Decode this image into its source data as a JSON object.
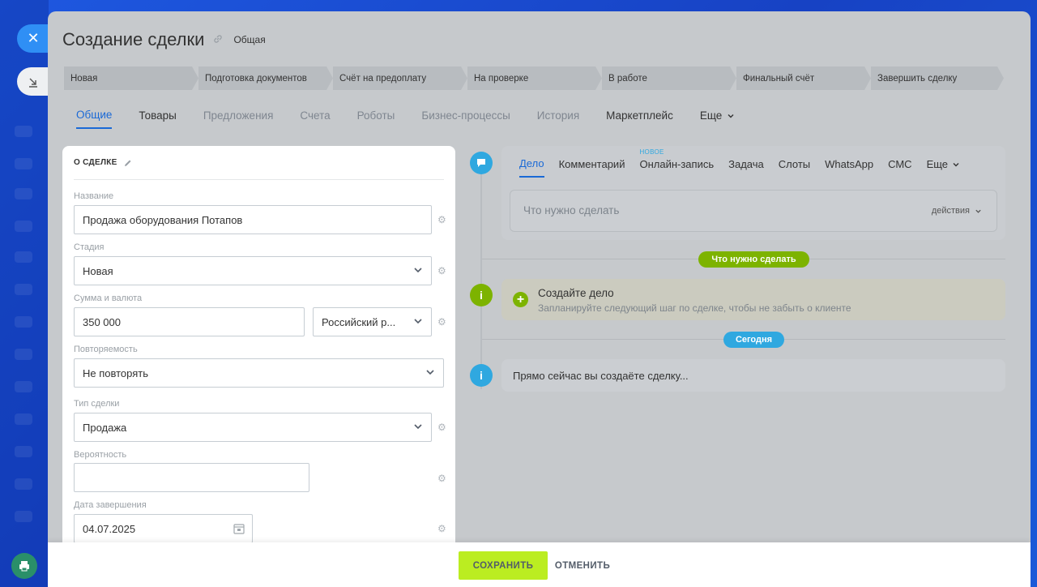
{
  "window": {
    "title": "Создание сделки",
    "category": "Общая"
  },
  "stages": [
    "Новая",
    "Подготовка документов",
    "Счёт на предоплату",
    "На проверке",
    "В работе",
    "Финальный счёт",
    "Завершить сделку"
  ],
  "tabs": [
    {
      "label": "Общие",
      "state": "active"
    },
    {
      "label": "Товары",
      "state": "dark"
    },
    {
      "label": "Предложения",
      "state": "muted"
    },
    {
      "label": "Счета",
      "state": "muted"
    },
    {
      "label": "Роботы",
      "state": "muted"
    },
    {
      "label": "Бизнес-процессы",
      "state": "muted"
    },
    {
      "label": "История",
      "state": "muted"
    },
    {
      "label": "Маркетплейс",
      "state": "dark"
    },
    {
      "label": "Еще",
      "state": "dark"
    }
  ],
  "deal_card": {
    "header": "О СДЕЛКЕ",
    "name_label": "Название",
    "name_value": "Продажа оборудования Потапов",
    "stage_label": "Стадия",
    "stage_value": "Новая",
    "amount_label": "Сумма и валюта",
    "amount_value": "350 000",
    "currency_value": "Российский р...",
    "repeat_label": "Повторяемость",
    "repeat_value": "Не повторять",
    "type_label": "Тип сделки",
    "type_value": "Продажа",
    "probability_label": "Вероятность",
    "probability_value": "",
    "close_date_label": "Дата завершения",
    "close_date_value": "04.07.2025"
  },
  "activity": {
    "tabs": [
      "Дело",
      "Комментарий",
      "Онлайн-запись",
      "Задача",
      "Слоты",
      "WhatsApp",
      "СМС",
      "Еще"
    ],
    "new_badge": "НОВОЕ",
    "todo_placeholder": "Что нужно сделать",
    "actions_label": "действия"
  },
  "timeline": {
    "todo_pill": "Что нужно сделать",
    "suggest_title": "Создайте дело",
    "suggest_sub": "Запланируйте следующий шаг по сделке, чтобы не забыть о клиенте",
    "today_pill": "Сегодня",
    "now_text": "Прямо сейчас вы создаёте сделку..."
  },
  "footer": {
    "save_label": "СОХРАНИТЬ",
    "cancel_label": "ОТМЕНИТЬ"
  },
  "colors": {
    "accent": "#1a69d6",
    "save": "#bbed21",
    "green": "#7db300",
    "blue_dot": "#2fa8e0",
    "close_btn": "#2f8ff5"
  }
}
